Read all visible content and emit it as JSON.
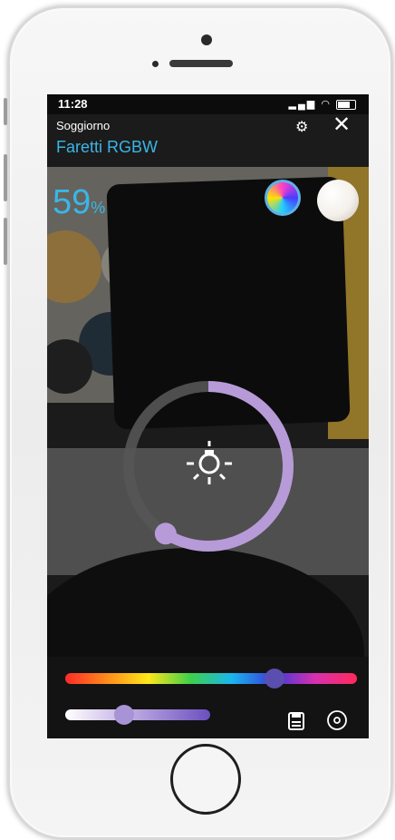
{
  "status_bar": {
    "time": "11:28",
    "signal": "..ll",
    "wifi": "wifi"
  },
  "header": {
    "room": "Soggiorno",
    "device_name": "Faretti RGBW",
    "settings_icon": "gears-icon",
    "close_label": "✕"
  },
  "brightness": {
    "value": "59",
    "unit": "%",
    "level": 0.59
  },
  "modes": [
    {
      "name": "rgb-mode",
      "selected": true
    },
    {
      "name": "white-mode",
      "selected": false
    }
  ],
  "dial": {
    "fraction": 0.59,
    "ring_color": "#b79bd8",
    "track_color": "#555555"
  },
  "hue_slider": {
    "position": 0.72,
    "thumb_color": "#5a4fb0"
  },
  "white_slider": {
    "position": 0.4,
    "thumb_color": "#a793d6"
  },
  "actions": {
    "save_icon": "save-icon",
    "target_icon": "target-icon"
  },
  "colors": {
    "accent": "#39b6e7",
    "ring": "#b79bd8"
  }
}
